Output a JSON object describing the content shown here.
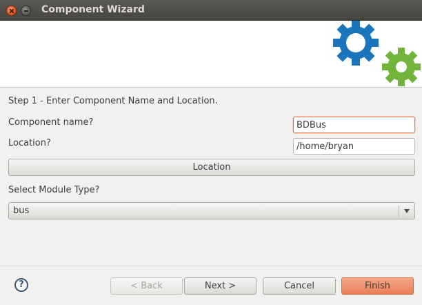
{
  "window": {
    "title": "Component Wizard"
  },
  "banner": {
    "logo_icon": "gears-icon",
    "gear_colors": [
      "#1b75bc",
      "#71b43b"
    ]
  },
  "form": {
    "step_text": "Step 1 - Enter Component Name and Location.",
    "component_name_label": "Component name?",
    "component_name_value": "BDBus",
    "location_label": "Location?",
    "location_value": "/home/bryan",
    "location_button": "Location",
    "module_type_label": "Select Module Type?",
    "module_type_value": "bus"
  },
  "footer": {
    "help_icon": "help-icon",
    "help_glyph": "?",
    "back_label": "< Back",
    "next_label": "Next >",
    "cancel_label": "Cancel",
    "finish_label": "Finish"
  }
}
